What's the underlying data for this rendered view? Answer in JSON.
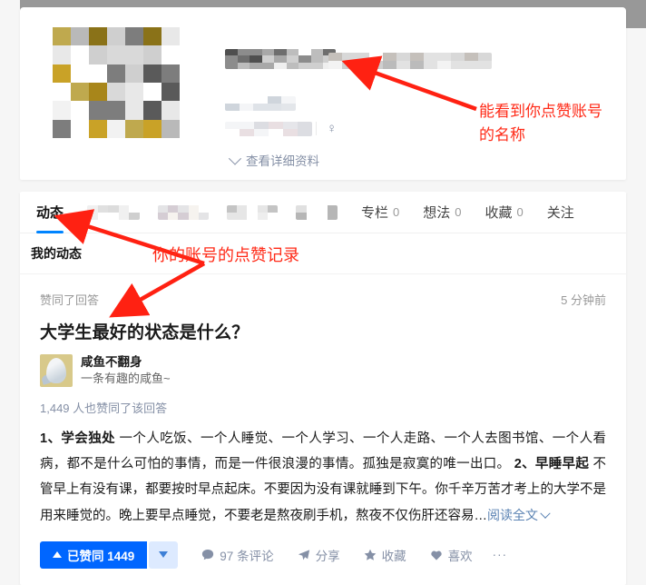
{
  "profile": {
    "name_redacted": true,
    "headline_redacted": true,
    "gender_icon": "female-symbol",
    "gender_glyph": "♀",
    "detail_link_label": "查看详细资料",
    "banner_color": "#989898"
  },
  "tabs": {
    "items": [
      {
        "label": "动态",
        "count": "",
        "active": true,
        "redacted": false
      },
      {
        "label": "",
        "count": "",
        "active": false,
        "redacted": true
      },
      {
        "label": "",
        "count": "",
        "active": false,
        "redacted": true
      },
      {
        "label": "",
        "count": "",
        "active": false,
        "redacted": true
      },
      {
        "label": "",
        "count": "",
        "active": false,
        "redacted": true
      },
      {
        "label": "专栏",
        "count": "0",
        "active": false,
        "redacted": false
      },
      {
        "label": "想法",
        "count": "0",
        "active": false,
        "redacted": false
      },
      {
        "label": "收藏",
        "count": "0",
        "active": false,
        "redacted": false
      },
      {
        "label": "关注",
        "count": "",
        "active": false,
        "redacted": false
      }
    ],
    "active_color": "#0084ff"
  },
  "subtab": {
    "label": "我的动态"
  },
  "feed": {
    "action_label": "赞同了回答",
    "time": "5 分钟前",
    "question_title": "大学生最好的状态是什么？",
    "author": {
      "name": "咸鱼不翻身",
      "bio": "一条有趣的咸鱼~"
    },
    "upvoters": "1,449 人也赞同了该回答",
    "body_part1_bold": "1、学会独处",
    "body_part1": " 一个人吃饭、一个人睡觉、一个人学习、一个人走路、一个人去图书馆、一个人看病，都不是什么可怕的事情，而是一件很浪漫的事情。孤独是寂寞的唯一出口。 ",
    "body_part2_bold": "2、早睡早起",
    "body_part2": " 不管早上有没有课，都要按时早点起床。不要因为没有课就睡到下午。你千辛万苦才考上的大学不是用来睡觉的。晚上要早点睡觉，不要老是熬夜刷手机，熬夜不仅伤肝还容易…",
    "read_more": "阅读全文"
  },
  "actions": {
    "vote_label": "已赞同 1449",
    "vote_count": "1449",
    "downvote_icon": "triangle-down-icon",
    "comment_label": "97 条评论",
    "comment_count": "97",
    "share_label": "分享",
    "favorite_label": "收藏",
    "like_label": "喜欢",
    "more_label": "···",
    "vote_bg": "#0066ff",
    "vote_down_bg": "#ddeaff",
    "icon_color": "#8590a6"
  },
  "annotations": {
    "items": [
      {
        "text": "能看到你点赞账号\n的名称",
        "color": "#ff2a17"
      },
      {
        "text": "你的账号的点赞记录",
        "color": "#ff2a17"
      }
    ],
    "arrow_color": "#ff2112"
  }
}
